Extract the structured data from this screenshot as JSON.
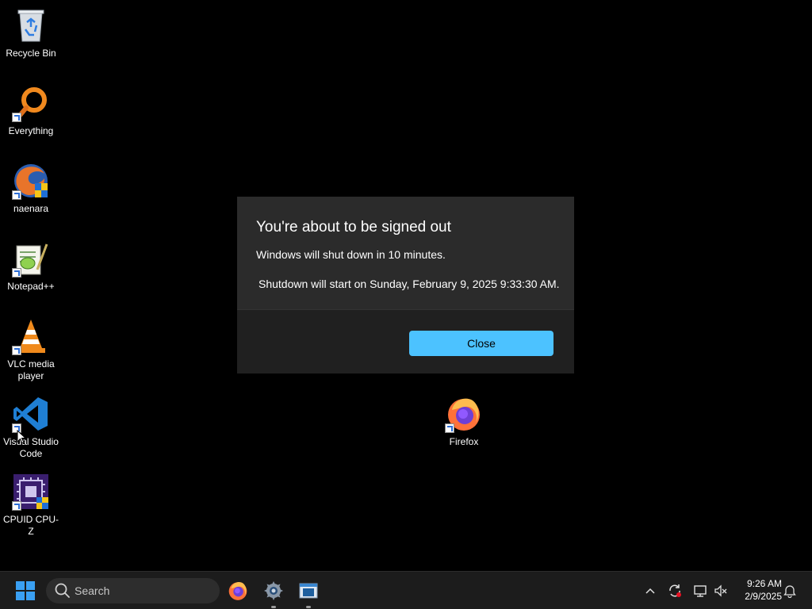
{
  "desktop": {
    "icons": [
      {
        "label": "Recycle Bin"
      },
      {
        "label": "Everything"
      },
      {
        "label": "naenara"
      },
      {
        "label": "Notepad++"
      },
      {
        "label": "VLC media player"
      },
      {
        "label": "Visual Studio Code"
      },
      {
        "label": "CPUID CPU-Z"
      },
      {
        "label": "Firefox"
      }
    ]
  },
  "dialog": {
    "title": "You're about to be signed out",
    "message": "Windows will shut down in 10 minutes.",
    "detail": "Shutdown will start on Sunday, February 9, 2025 9:33:30 AM.",
    "close_label": "Close"
  },
  "taskbar": {
    "search_placeholder": "Search",
    "clock_time": "9:26 AM",
    "clock_date": "2/9/2025"
  },
  "colors": {
    "accent": "#4cc2ff",
    "dialog_bg": "#2b2b2b",
    "dialog_footer_bg": "#202020",
    "taskbar_bg": "#1c1c1c"
  }
}
